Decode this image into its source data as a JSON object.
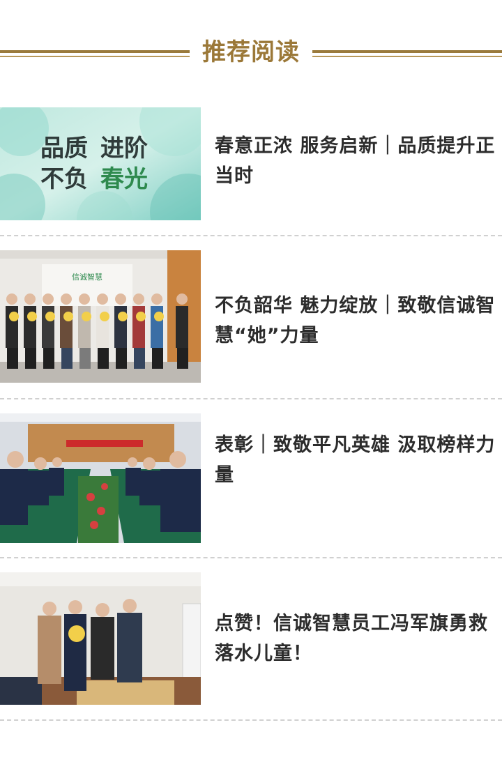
{
  "section": {
    "title": "推荐阅读"
  },
  "articles": [
    {
      "title": "春意正浓 服务启新｜品质提升正当时",
      "thumb": {
        "type": "graphic",
        "line1_a": "品质",
        "line1_b": "进阶",
        "line2_a": "不负",
        "line2_b": "春光"
      }
    },
    {
      "title": "不负韶华 魅力绽放｜致敬信诚智慧“她”力量",
      "thumb": {
        "type": "photo",
        "subject": "women-group-photo",
        "sign_text": "信诚智慧"
      }
    },
    {
      "title": "表彰｜致敬平凡英雄 汲取榜样力量",
      "thumb": {
        "type": "photo",
        "subject": "meeting-room-photo"
      }
    },
    {
      "title": "点赞！信诚智慧员工冯军旗勇救落水儿童！",
      "thumb": {
        "type": "photo",
        "subject": "award-presentation-photo"
      }
    }
  ],
  "colors": {
    "accent": "#9b7838",
    "title_text": "#2c2c2c",
    "divider": "#d0d0d0"
  }
}
